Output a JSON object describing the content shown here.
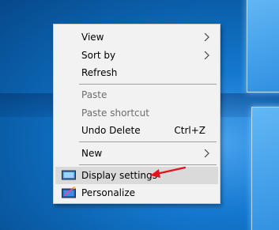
{
  "colors": {
    "menu_bg": "#f2f2f2",
    "highlight_bg": "#dadada",
    "disabled_text": "#6d6d6d",
    "annotation_arrow": "#e3141b",
    "desktop_blue": "#0a66b8"
  },
  "context_menu": {
    "view": {
      "label": "View",
      "submenu": true
    },
    "sort_by": {
      "label": "Sort by",
      "submenu": true
    },
    "refresh": {
      "label": "Refresh"
    },
    "paste": {
      "label": "Paste",
      "enabled": false
    },
    "paste_shortcut": {
      "label": "Paste shortcut",
      "enabled": false
    },
    "undo_delete": {
      "label": "Undo Delete",
      "shortcut": "Ctrl+Z"
    },
    "new": {
      "label": "New",
      "submenu": true
    },
    "display_settings": {
      "label": "Display settings",
      "icon": "display-settings-icon",
      "highlighted": true
    },
    "personalize": {
      "label": "Personalize",
      "icon": "personalize-icon"
    }
  }
}
